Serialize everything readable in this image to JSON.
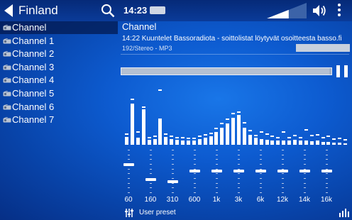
{
  "header": {
    "title": "Finland",
    "time": "14:23",
    "volume_level": 0.55
  },
  "sidebar": {
    "items": [
      {
        "label": "Channel",
        "active": true
      },
      {
        "label": "Channel 1",
        "active": false
      },
      {
        "label": "Channel 2",
        "active": false
      },
      {
        "label": "Channel 3",
        "active": false
      },
      {
        "label": "Channel 4",
        "active": false
      },
      {
        "label": "Channel 5",
        "active": false
      },
      {
        "label": "Channel 6",
        "active": false
      },
      {
        "label": "Channel 7",
        "active": false
      }
    ]
  },
  "player": {
    "channel": "Channel",
    "track": "14:22 Kuuntelet Bassoradiota - soittolistat löytyvät osoitteesta basso.fi",
    "meta": "192/Stereo - MP3",
    "progress": 0.99
  },
  "equalizer": {
    "spectrum": [
      0.14,
      0.72,
      0.12,
      0.63,
      0.09,
      0.1,
      0.46,
      0.14,
      0.1,
      0.09,
      0.08,
      0.07,
      0.08,
      0.1,
      0.12,
      0.15,
      0.23,
      0.3,
      0.38,
      0.48,
      0.52,
      0.3,
      0.18,
      0.12,
      0.1,
      0.09,
      0.08,
      0.07,
      0.08,
      0.07,
      0.09,
      0.08,
      0.07,
      0.06,
      0.07,
      0.05,
      0.05,
      0.04,
      0.04,
      0.03
    ],
    "peaks": [
      0.16,
      0.78,
      0.2,
      0.64,
      0.1,
      0.12,
      0.94,
      0.16,
      0.12,
      0.1,
      0.1,
      0.09,
      0.09,
      0.13,
      0.15,
      0.18,
      0.26,
      0.35,
      0.42,
      0.52,
      0.55,
      0.36,
      0.22,
      0.14,
      0.2,
      0.16,
      0.12,
      0.1,
      0.2,
      0.1,
      0.14,
      0.1,
      0.24,
      0.14,
      0.15,
      0.1,
      0.12,
      0.08,
      0.09,
      0.06
    ],
    "bands": [
      {
        "label": "60",
        "gain": 0.65
      },
      {
        "label": "160",
        "gain": 0.3
      },
      {
        "label": "310",
        "gain": 0.25
      },
      {
        "label": "600",
        "gain": 0.5
      },
      {
        "label": "1k",
        "gain": 0.5
      },
      {
        "label": "3k",
        "gain": 0.5
      },
      {
        "label": "6k",
        "gain": 0.5
      },
      {
        "label": "12k",
        "gain": 0.5
      },
      {
        "label": "14k",
        "gain": 0.5
      },
      {
        "label": "16k",
        "gain": 0.5
      }
    ],
    "preset": "User preset"
  }
}
